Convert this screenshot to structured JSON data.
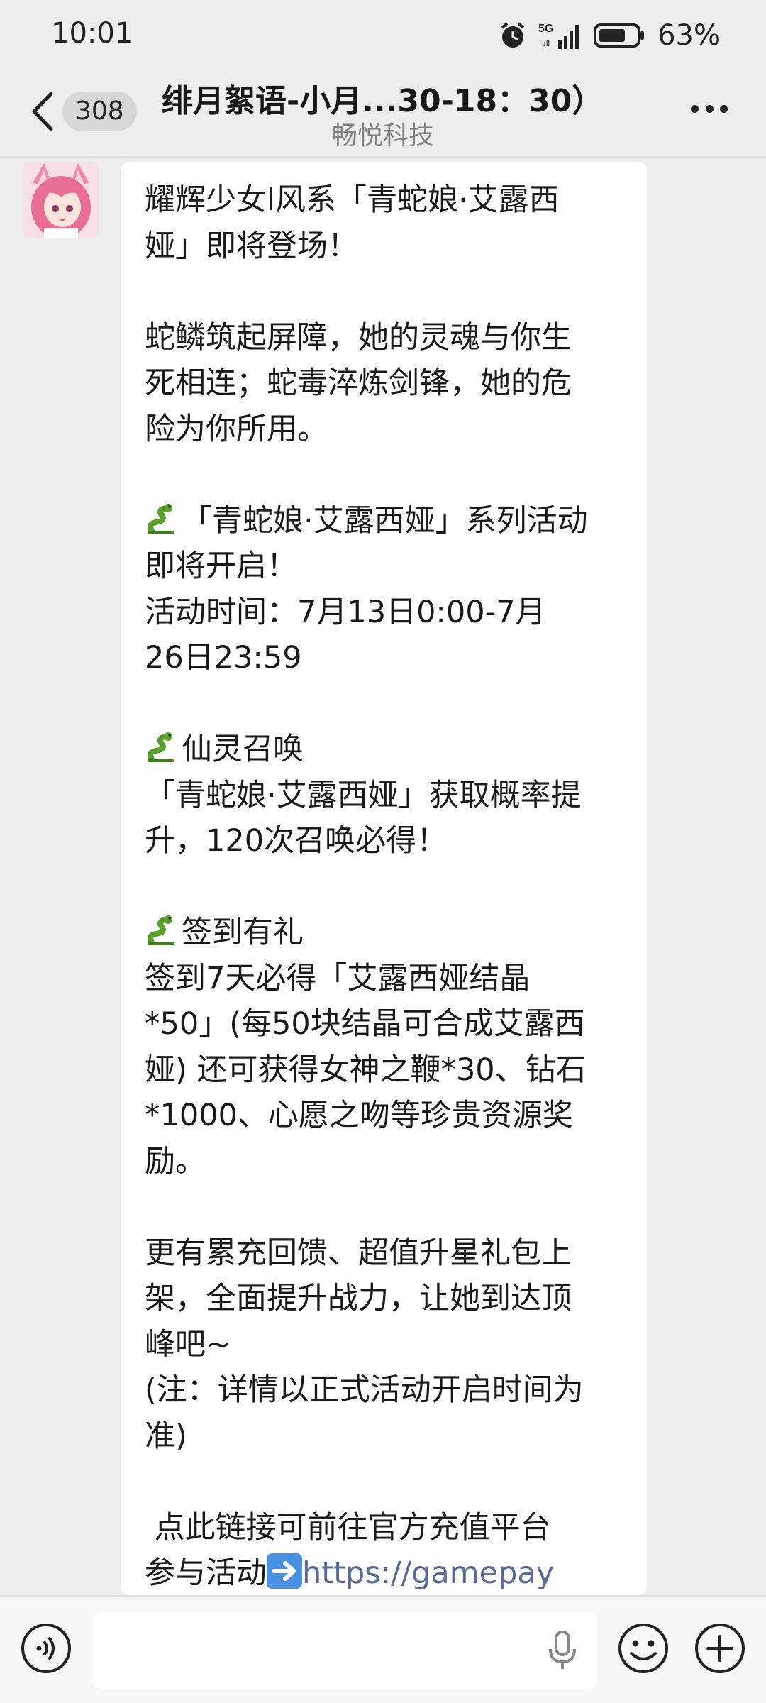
{
  "status_bar": {
    "time": "10:01",
    "network": "5G",
    "battery": "63%"
  },
  "header": {
    "back_icon": "chevron-left-icon",
    "unread_count": "308",
    "title": "绯月絮语-小月...30-18：30）",
    "subtitle": "畅悦科技",
    "more_icon": "more-dots-icon"
  },
  "message": {
    "line01": "耀辉少女l风系「青蛇娘·艾露西",
    "line02": "娅」即将登场！",
    "line03": "蛇鳞筑起屏障，她的灵魂与你生",
    "line04": "死相连；蛇毒淬炼剑锋，她的危",
    "line05": "险为你所用。",
    "line06": "「青蛇娘·艾露西娅」系列活动",
    "line07": "即将开启！",
    "line08": "活动时间：7月13日0:00-7月",
    "line09": "26日23:59",
    "line10": "仙灵召唤",
    "line11": "「青蛇娘·艾露西娅」获取概率提",
    "line12": "升，120次召唤必得！",
    "line13": "签到有礼",
    "line14": "签到7天必得「艾露西娅结晶",
    "line15": "*50」(每50块结晶可合成艾露西",
    "line16": "娅) 还可获得女神之鞭*30、钻石",
    "line17": "*1000、心愿之吻等珍贵资源奖",
    "line18": "励。",
    "line19": "更有累充回馈、超值升星礼包上",
    "line20": "架，全面提升战力，让她到达顶",
    "line21": "峰吧~",
    "line22": "(注：详情以正式活动开启时间为",
    "line23": "准)",
    "line24": " 点此链接可前往官方充值平台",
    "line25": "参与活动",
    "link_text": "https://gamepay",
    "snake_icon": "snake-emoji-icon",
    "arrow_icon": "right-arrow-emoji-icon"
  },
  "input_bar": {
    "voice_icon": "voice-mode-icon",
    "mic_icon": "microphone-icon",
    "emoji_icon": "smiley-icon",
    "plus_icon": "plus-circle-icon"
  },
  "colors": {
    "background": "#ededed",
    "bubble": "#ffffff",
    "link": "#576b95",
    "subtitle": "#7f7f7f"
  }
}
